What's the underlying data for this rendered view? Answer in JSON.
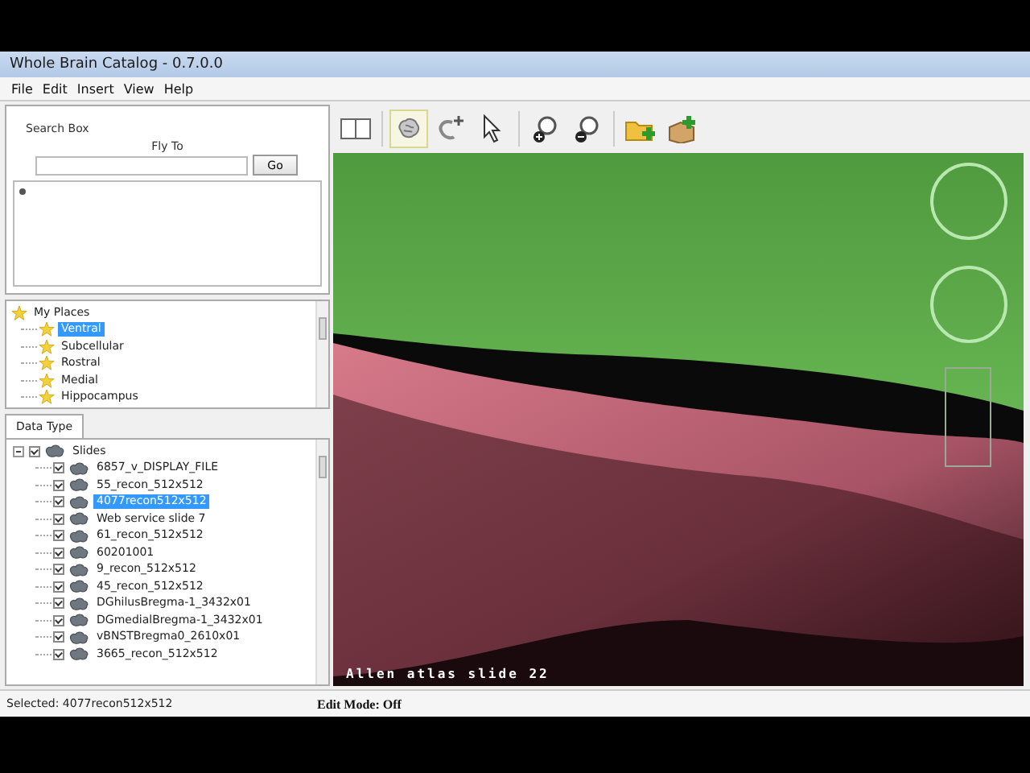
{
  "window": {
    "title": "Whole Brain Catalog - 0.7.0.0"
  },
  "menu": [
    "File",
    "Edit",
    "Insert",
    "View",
    "Help"
  ],
  "search_box": {
    "heading": "Search Box",
    "fly_to_label": "Fly To",
    "go_button": "Go"
  },
  "my_places": {
    "label": "My Places",
    "items": [
      {
        "label": "Ventral",
        "selected": true
      },
      {
        "label": "Subcellular",
        "selected": false
      },
      {
        "label": "Rostral",
        "selected": false
      },
      {
        "label": "Medial",
        "selected": false
      },
      {
        "label": "Hippocampus",
        "selected": false
      }
    ]
  },
  "data_type": {
    "tab": "Data Type",
    "slides": {
      "label": "Slides",
      "checked": true,
      "expanded": true,
      "items": [
        {
          "label": "6857_v_DISPLAY_FILE",
          "checked": true,
          "selected": false
        },
        {
          "label": "55_recon_512x512",
          "checked": true,
          "selected": false
        },
        {
          "label": "4077recon512x512",
          "checked": true,
          "selected": true
        },
        {
          "label": "Web service slide 7",
          "checked": true,
          "selected": false
        },
        {
          "label": "61_recon_512x512",
          "checked": true,
          "selected": false
        },
        {
          "label": "60201001",
          "checked": true,
          "selected": false
        },
        {
          "label": "9_recon_512x512",
          "checked": true,
          "selected": false
        },
        {
          "label": "45_recon_512x512",
          "checked": true,
          "selected": false
        },
        {
          "label": "DGhilusBregma-1_3432x01",
          "checked": true,
          "selected": false
        },
        {
          "label": "DGmedialBregma-1_3432x01",
          "checked": true,
          "selected": false
        },
        {
          "label": "vBNSTBregma0_2610x01",
          "checked": true,
          "selected": false
        },
        {
          "label": "3665_recon_512x512",
          "checked": true,
          "selected": false
        }
      ]
    }
  },
  "toolbar": [
    {
      "kind": "split",
      "selected": false
    },
    {
      "kind": "brain",
      "selected": true
    },
    {
      "kind": "rotate",
      "selected": false
    },
    {
      "kind": "pointer",
      "selected": false
    },
    {
      "kind": "zoom_in",
      "selected": false
    },
    {
      "kind": "zoom_out",
      "selected": false
    },
    {
      "kind": "add_folder",
      "selected": false
    },
    {
      "kind": "add_box",
      "selected": false
    }
  ],
  "viewer": {
    "caption": "Allen atlas slide 22"
  },
  "status_bar": {
    "selected": "Selected: 4077recon512x512",
    "edit_mode": "Edit Mode: Off"
  }
}
